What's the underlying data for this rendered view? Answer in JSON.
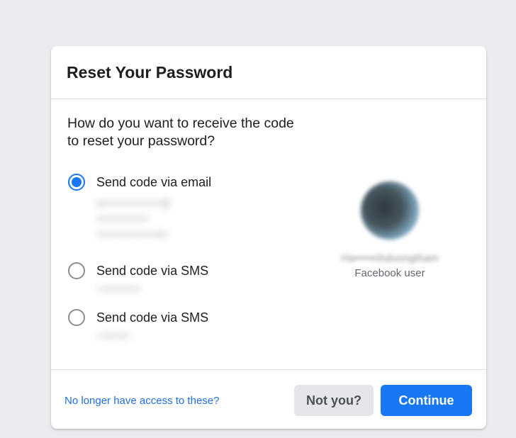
{
  "dialog": {
    "title": "Reset Your Password",
    "question": "How do you want to receive the code to reset your password?",
    "options": [
      {
        "label": "Send code via email",
        "selected": true,
        "detail_lines": [
          "a•••••••••••••••••@",
          "•••••••••••••••",
          "••••••••••••••••••m"
        ]
      },
      {
        "label": "Send code via SMS",
        "selected": false,
        "detail_lines": [
          "+•••••••••••"
        ]
      },
      {
        "label": "Send code via SMS",
        "selected": false,
        "detail_lines": [
          "+••••••••"
        ]
      }
    ],
    "profile": {
      "name": "Ha•••••nhduongtham",
      "subtitle": "Facebook user"
    },
    "footer": {
      "access_link": "No longer have access to these?",
      "not_you_button": "Not you?",
      "continue_button": "Continue"
    },
    "colors": {
      "accent": "#1877f2",
      "link": "#216fdb",
      "background": "#e9ebee"
    }
  }
}
